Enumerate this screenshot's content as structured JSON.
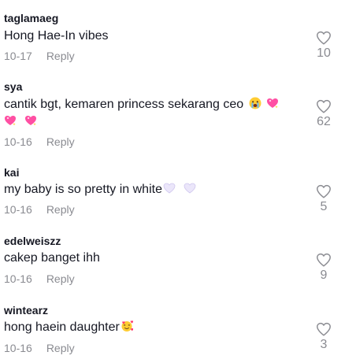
{
  "comments": [
    {
      "username": "taglamaeg",
      "text": "Hong Hae-In vibes",
      "date": "10-17",
      "reply_label": "Reply",
      "likes": "10",
      "emojis": []
    },
    {
      "username": "sya",
      "text": "cantik bgt, kemaren princess sekarang ceo",
      "date": "10-16",
      "reply_label": "Reply",
      "likes": "62",
      "emojis": [
        "crying-face-emoji",
        "sparkling-heart-emoji",
        "sparkling-heart-emoji",
        "sparkling-heart-emoji"
      ]
    },
    {
      "username": "kai",
      "text": "my baby is so pretty in white",
      "date": "10-16",
      "reply_label": "Reply",
      "likes": "5",
      "emojis": [
        "white-heart-emoji",
        "white-heart-emoji"
      ]
    },
    {
      "username": "edelweiszz",
      "text": "cakep banget ihh",
      "date": "10-16",
      "reply_label": "Reply",
      "likes": "9",
      "emojis": []
    },
    {
      "username": "wintearz",
      "text": "hong haein daughter",
      "date": "10-16",
      "reply_label": "Reply",
      "likes": "3",
      "emojis": [
        "smiling-face-with-hearts-emoji"
      ]
    }
  ],
  "colors": {
    "text": "#161823",
    "muted": "#8a8b91",
    "heart_outline": "#8a8b91",
    "sparkling_heart": "#ff4fa3",
    "white_heart": "#d9d2f2"
  }
}
